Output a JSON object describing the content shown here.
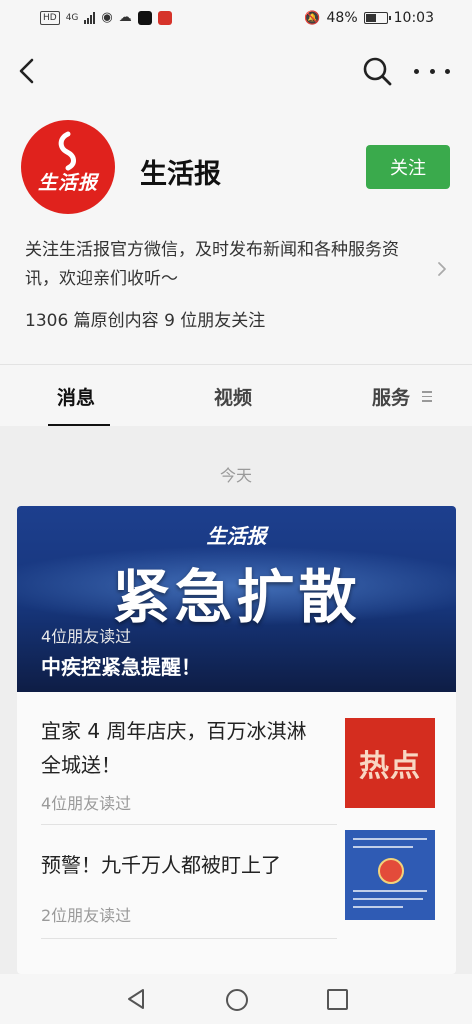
{
  "status_bar": {
    "network_tag": "HD",
    "network_type": "4G",
    "battery_percent": "48%",
    "time": "10:03"
  },
  "account": {
    "name": "生活报",
    "logo_text": "生活报",
    "follow_label": "关注",
    "description": "关注生活报官方微信，及时发布新闻和各种服务资讯，欢迎亲们收听～",
    "stats": "1306 篇原创内容  9 位朋友关注"
  },
  "tabs": [
    {
      "label": "消息",
      "active": true
    },
    {
      "label": "视频",
      "active": false
    },
    {
      "label": "服务",
      "active": false
    }
  ],
  "feed": {
    "date_label": "今天",
    "banner": {
      "logo_text": "生活报",
      "title": "紧急扩散",
      "read_count": "4位朋友读过",
      "headline": "中疾控紧急提醒！"
    },
    "articles": [
      {
        "title": "宜家 4 周年店庆，百万冰淇淋全城送！",
        "read_count": "4位朋友读过",
        "thumb_text": "热点"
      },
      {
        "title": "预警！九千万人都被盯上了",
        "read_count": "2位朋友读过"
      }
    ]
  },
  "colors": {
    "accent_green": "#3aaa4c",
    "logo_red": "#e0221d",
    "banner_blue": "#1d3f8e"
  }
}
